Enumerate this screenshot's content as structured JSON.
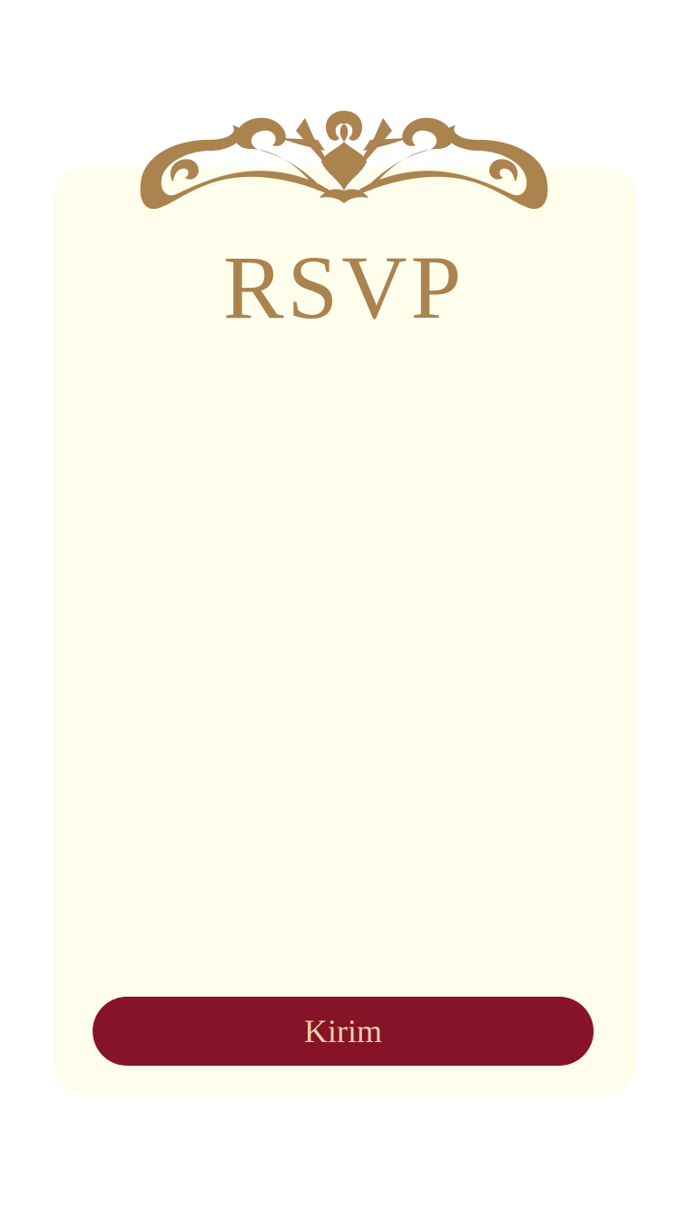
{
  "rsvp": {
    "title": "RSVP",
    "submit_label": "Kirim"
  },
  "colors": {
    "page_background": "#FFFFFF",
    "card_background": "#FFFDEB",
    "gold_accent": "#AB834E",
    "button_background": "#861328",
    "button_text": "#F6D1A5"
  },
  "icons": {
    "ornament": "scroll-ornament-icon"
  }
}
